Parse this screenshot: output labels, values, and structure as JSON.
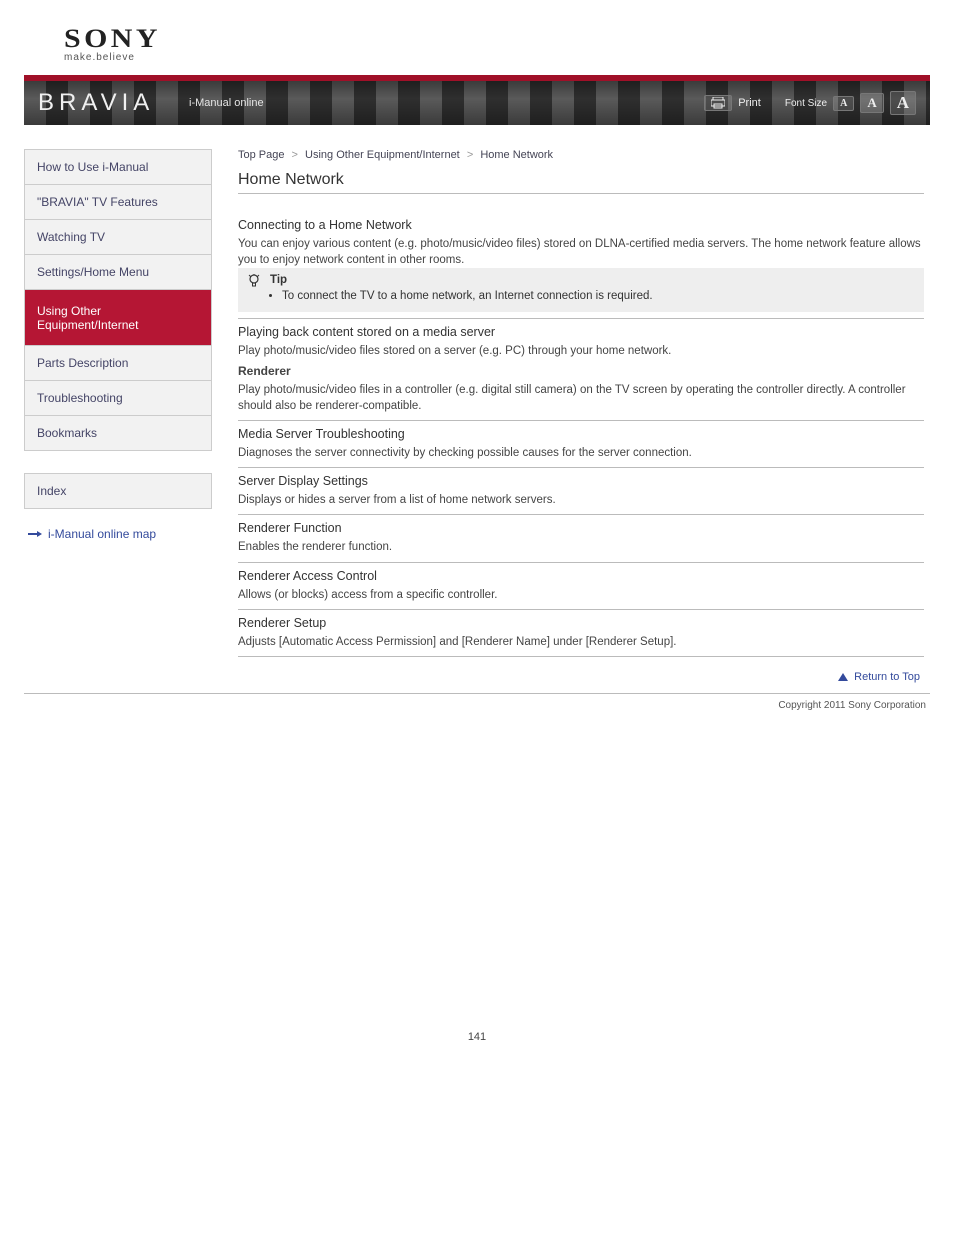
{
  "logo": {
    "brand": "SONY",
    "tagline": "make.believe"
  },
  "banner": {
    "productBrand": "BRAVIA",
    "guide": "i-Manual online",
    "printLabel": "Print",
    "fontSizeLabel": "Font Size",
    "A_small": "A",
    "A_med": "A",
    "A_large": "A"
  },
  "breadcrumb": {
    "a": "Top Page",
    "b": "Using Other Equipment/Internet",
    "c": "Home Network",
    "sep": ">"
  },
  "sidebar": {
    "items": [
      {
        "label": "How to Use i-Manual"
      },
      {
        "label": "\"BRAVIA\" TV Features"
      },
      {
        "label": "Watching TV"
      },
      {
        "label": "Settings/Home Menu"
      },
      {
        "label": "Using Other Equipment/Internet"
      },
      {
        "label": "Parts Description"
      },
      {
        "label": "Troubleshooting"
      },
      {
        "label": "Bookmarks"
      },
      {
        "label": "Index"
      }
    ],
    "trademark": "i-Manual online map"
  },
  "sectionTitle": "Home Network",
  "items": [
    {
      "title": "Connecting to a Home Network",
      "body": "You can enjoy various content (e.g. photo/music/video files) stored on DLNA-certified media servers. The home network feature allows you to enjoy network content in other rooms.",
      "tip": {
        "label": "Tip",
        "bullet": "To connect the TV to a home network, an Internet connection is required."
      }
    },
    {
      "title": "Playing back content stored on a media server",
      "body": {
        "p1": "Play photo/music/video files stored on a server (e.g. PC) through your home network.",
        "h": "Renderer",
        "p2": "Play photo/music/video files in a controller (e.g. digital still camera) on the TV screen by operating the controller directly. A controller should also be renderer-compatible."
      }
    },
    {
      "title": "Media Server Troubleshooting",
      "body": "Diagnoses the server connectivity by checking possible causes for the server connection."
    },
    {
      "title": "Server Display Settings",
      "body": "Displays or hides a server from a list of home network servers."
    },
    {
      "title": "Renderer Function",
      "body": "Enables the renderer function."
    },
    {
      "title": "Renderer Access Control",
      "body": "Allows (or blocks) access from a specific controller."
    },
    {
      "title": "Renderer Setup",
      "body": "Adjusts [Automatic Access Permission] and [Renderer Name] under [Renderer Setup]."
    }
  ],
  "backToTop": "Return to Top",
  "copyright": "Copyright 2011 Sony Corporation",
  "pageNumber": "141"
}
